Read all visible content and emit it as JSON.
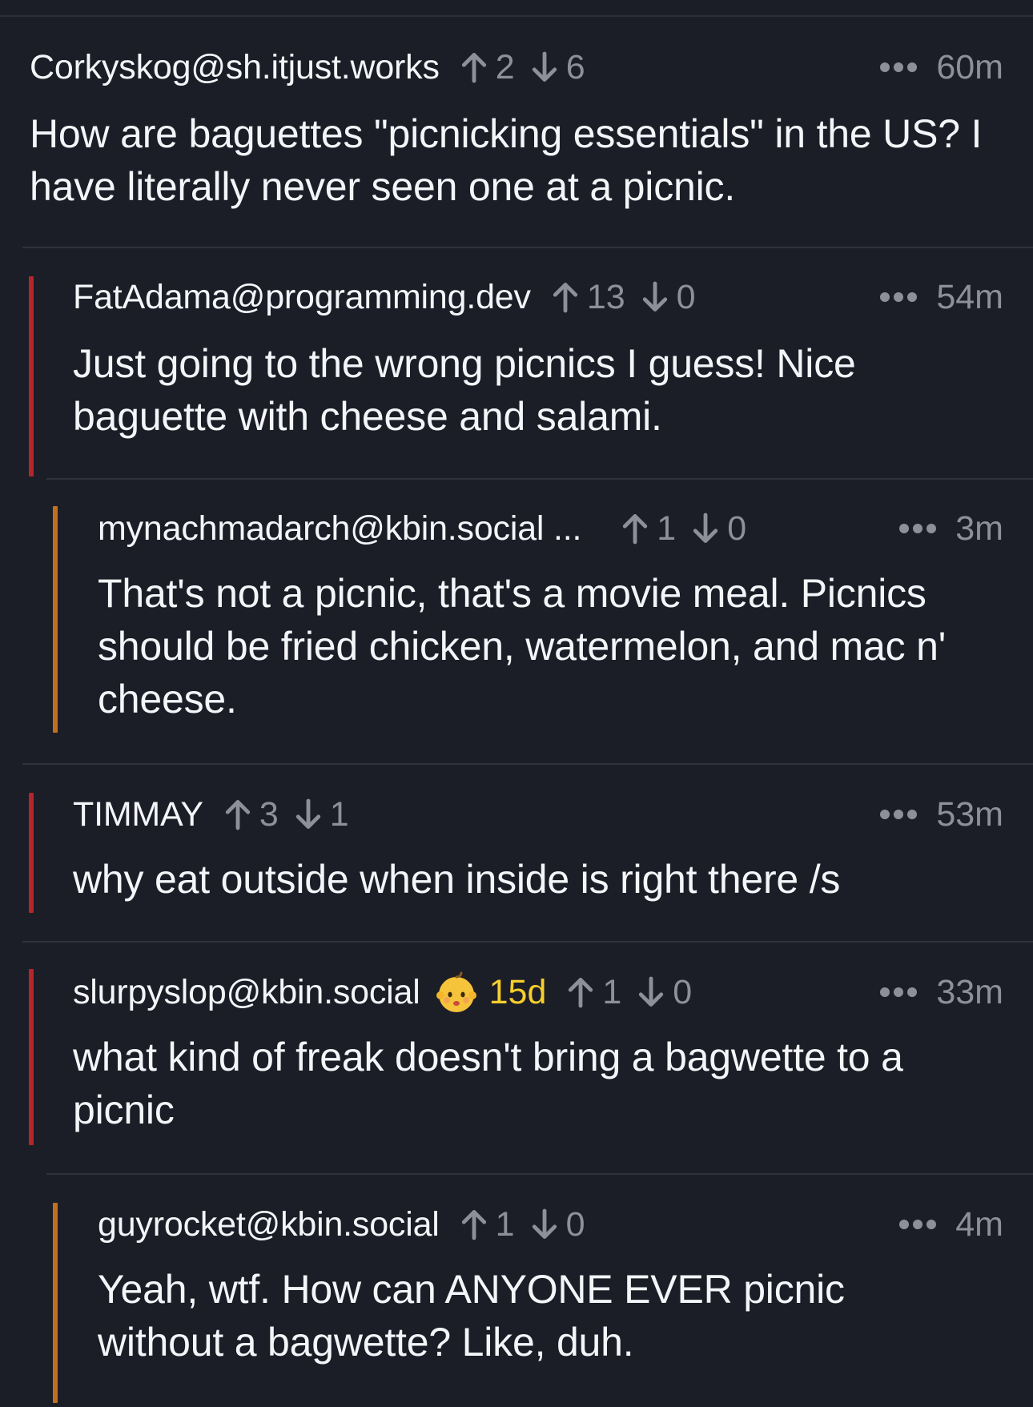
{
  "colors": {
    "background": "#1c1e27",
    "divider": "#2f323d",
    "thread_bar_level1": "#b3262b",
    "thread_bar_level2": "#c0701e",
    "muted": "#8d909a",
    "age_badge": "#f6cf2d"
  },
  "comments": [
    {
      "author": "Corkyskog@sh.itjust.works",
      "upvotes": "2",
      "downvotes": "6",
      "time": "60m",
      "text": "How are baguettes \"picnicking essentials\" in the US? I have literally never seen one at a picnic."
    },
    {
      "author": "FatAdama@programming.dev",
      "upvotes": "13",
      "downvotes": "0",
      "time": "54m",
      "text": "Just going to the wrong picnics I guess! Nice baguette with cheese and salami."
    },
    {
      "author": "mynachmadarch@kbin.social ...",
      "upvotes": "1",
      "downvotes": "0",
      "time": "3m",
      "text": "That's not a picnic, that's a movie meal. Picnics should be fried chicken, watermelon, and mac n' cheese."
    },
    {
      "author": "TIMMAY",
      "upvotes": "3",
      "downvotes": "1",
      "time": "53m",
      "text": "why eat outside when inside is right there /s"
    },
    {
      "author": "slurpyslop@kbin.social",
      "badge_icon": "baby-face-icon",
      "account_age": "15d",
      "upvotes": "1",
      "downvotes": "0",
      "time": "33m",
      "text": "what kind of freak doesn't bring a bagwette to a picnic"
    },
    {
      "author": "guyrocket@kbin.social",
      "upvotes": "1",
      "downvotes": "0",
      "time": "4m",
      "text": "Yeah, wtf. How can ANYONE EVER picnic without a bagwette? Like, duh."
    }
  ]
}
